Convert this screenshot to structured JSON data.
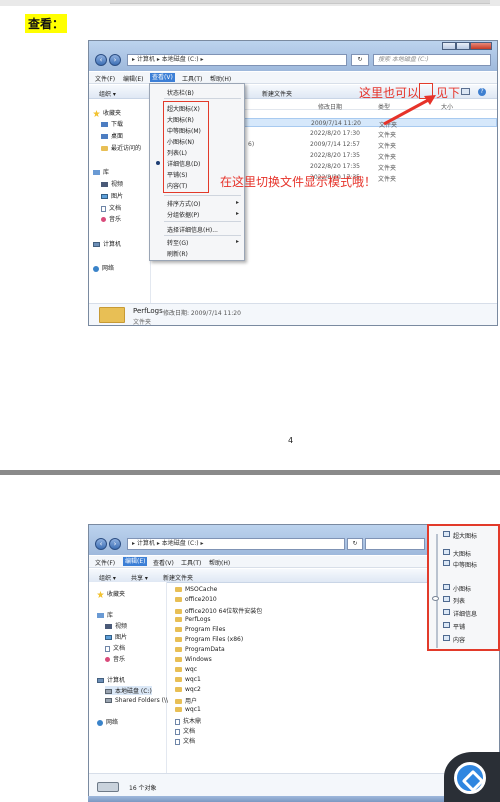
{
  "heading": "查看：",
  "page_number": "4",
  "window1": {
    "address": [
      "计算机",
      "本地磁盘 (C:)"
    ],
    "search_placeholder": "搜索 本地磁盘 (C:)",
    "menu": [
      "文件(F)",
      "编辑(E)",
      "查看(V)",
      "工具(T)",
      "帮助(H)"
    ],
    "toolbar": [
      "组织 ▾",
      "新建文件夹"
    ],
    "nav": {
      "favorites": "收藏夹",
      "items": [
        "下载",
        "桌面",
        "最近访问的"
      ],
      "libraries": "库",
      "lib_items": [
        "视频",
        "图片",
        "文档",
        "音乐"
      ],
      "computer": "计算机",
      "network": "网络"
    },
    "columns": [
      "修改日期",
      "类型",
      "大小"
    ],
    "rows": [
      {
        "partial": "",
        "date": "2009/7/14 11:20",
        "type": "文件夹"
      },
      {
        "partial": "",
        "date": "2022/8/20 17:30",
        "type": "文件夹"
      },
      {
        "partial": "6)",
        "date": "2009/7/14 12:57",
        "type": "文件夹"
      },
      {
        "partial": "",
        "date": "2022/8/20 17:35",
        "type": "文件夹"
      },
      {
        "partial": "",
        "date": "2022/8/20 17:35",
        "type": "文件夹"
      },
      {
        "partial": "",
        "date": "2022/8/20 17:35",
        "type": "文件夹"
      }
    ],
    "status": {
      "name": "PerfLogs",
      "detail": "修改日期: 2009/7/14 11:20",
      "kind": "文件夹"
    }
  },
  "dropdown": {
    "status_bar": "状态栏(B)",
    "view_modes": [
      "超大图标(X)",
      "大图标(R)",
      "中等图标(M)",
      "小图标(N)",
      "列表(L)",
      "详细信息(D)",
      "平铺(S)",
      "内容(T)"
    ],
    "sort": "排序方式(O)",
    "group": "分组依据(P)",
    "choose": "选择详细信息(H)...",
    "goto": "转至(G)",
    "refresh": "刷新(R)"
  },
  "annotations": {
    "here_too": "这里也可以",
    "see_below": "见下",
    "switch_tip": "在这里切换文件显示模式哦！"
  },
  "window2": {
    "address": [
      "计算机",
      "本地磁盘 (C:)"
    ],
    "menu": [
      "文件(F)",
      "编辑(E)",
      "查看(V)",
      "工具(T)",
      "帮助(H)"
    ],
    "toolbar": [
      "组织 ▾",
      "共享 ▾",
      "新建文件夹"
    ],
    "nav": {
      "favorites": "收藏夹",
      "libraries": "库",
      "lib_items": [
        "视频",
        "图片",
        "文档",
        "音乐"
      ],
      "computer": "计算机",
      "drives": [
        "本地磁盘 (C:)",
        "Shared Folders (\\\\"
      ],
      "network": "网络"
    },
    "files": [
      "MSOCache",
      "office2010",
      "office2010 64位软件安装包",
      "PerfLogs",
      "Program Files",
      "Program Files (x86)",
      "ProgramData",
      "Windows",
      "wqc",
      "wqc1",
      "wqc2",
      "用户",
      "wqc1",
      "抗木鼎",
      "文档",
      "文档"
    ],
    "status": "16 个对象",
    "view_options": [
      "超大图标",
      "大图标",
      "中等图标",
      "小图标",
      "列表",
      "详细信息",
      "平铺",
      "内容"
    ]
  }
}
